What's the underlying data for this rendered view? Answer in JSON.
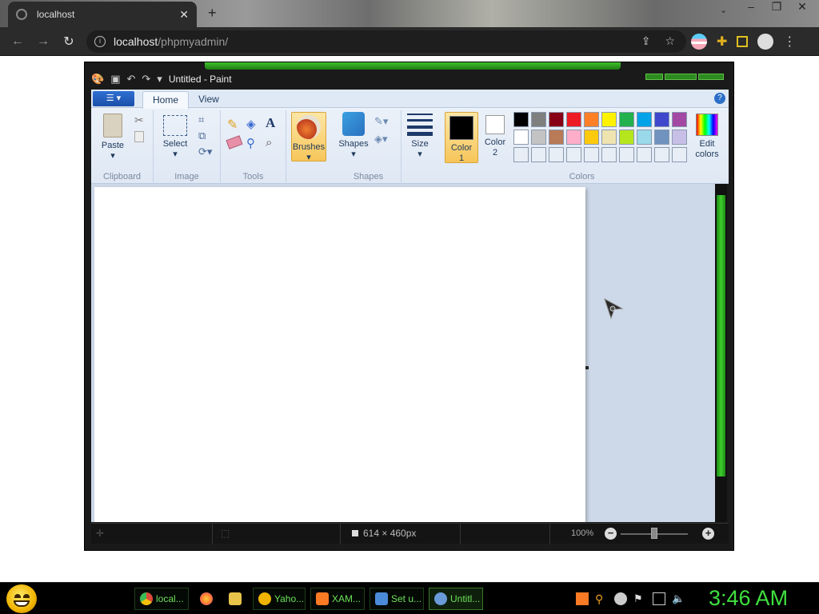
{
  "browser": {
    "tab_title": "localhost",
    "tab_close": "✕",
    "new_tab": "+",
    "url_host": "localhost",
    "url_path": "/phpmyadmin/",
    "nav": {
      "back": "←",
      "forward": "→",
      "reload": "↻"
    },
    "window_buttons": [
      "–",
      "❐",
      "✕"
    ],
    "tab_dropdown": "⌄"
  },
  "paint": {
    "window_title": "Untitled - Paint",
    "tabs": [
      {
        "label": "Home",
        "active": true
      },
      {
        "label": "View",
        "active": false
      }
    ],
    "help_icon": "?",
    "groups": {
      "clipboard": {
        "label": "Clipboard",
        "paste": "Paste"
      },
      "image": {
        "label": "Image",
        "select": "Select"
      },
      "tools": {
        "label": "Tools"
      },
      "brushes": {
        "label": "Brushes"
      },
      "shapes": {
        "label": "Shapes",
        "shapes_btn": "Shapes"
      },
      "size": {
        "label": "Size"
      },
      "colors": {
        "label": "Colors",
        "color1": "Color 1",
        "color1_l1": "Color",
        "color1_l2": "1",
        "color2_l1": "Color",
        "color2_l2": "2",
        "edit_l1": "Edit",
        "edit_l2": "colors",
        "palette_row1": [
          "#000000",
          "#7f7f7f",
          "#880015",
          "#ed1c24",
          "#ff7f27",
          "#fff200",
          "#22b14c",
          "#00a2e8",
          "#3f48cc",
          "#a349a4"
        ],
        "palette_row2": [
          "#ffffff",
          "#c3c3c3",
          "#b97a57",
          "#ffaec9",
          "#ffc90e",
          "#efe4b0",
          "#b5e61d",
          "#99d9ea",
          "#7092be",
          "#c8bfe7"
        ],
        "color1_value": "#000000",
        "color2_value": "#ffffff"
      }
    },
    "status": {
      "dimensions": "614 × 460px",
      "zoom": "100%",
      "zoom_level_fraction": 0.5
    }
  },
  "taskbar": {
    "items": [
      {
        "label": "local...",
        "icon": "chrome-icon",
        "color": "#dd4b39"
      },
      {
        "label": "",
        "icon": "firefox-icon",
        "color": "#ff7139"
      },
      {
        "label": "",
        "icon": "folder-icon",
        "color": "#e8c34a"
      },
      {
        "label": "Yaho...",
        "icon": "yahoo-messenger-icon",
        "color": "#f0b400"
      },
      {
        "label": "XAM...",
        "icon": "xampp-icon",
        "color": "#fb7a24"
      },
      {
        "label": "Set u...",
        "icon": "setup-icon",
        "color": "#4a8ad8"
      },
      {
        "label": "Untitl...",
        "icon": "paint-icon",
        "color": "#6a9ad8"
      }
    ],
    "clock": "3:46 AM"
  }
}
